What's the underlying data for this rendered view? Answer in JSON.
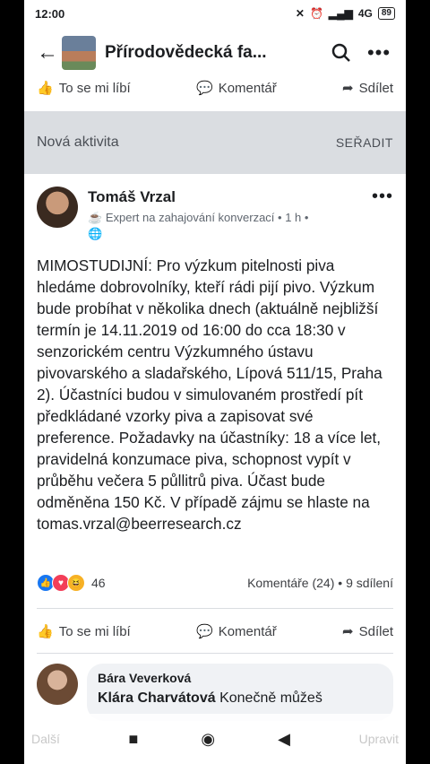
{
  "status": {
    "time": "12:00",
    "signal": "4G",
    "battery": "89"
  },
  "appbar": {
    "title": "Přírodovědecká fa..."
  },
  "actions": {
    "like": "To se mi líbí",
    "comment": "Komentář",
    "share": "Sdílet"
  },
  "activity": {
    "title": "Nová aktivita",
    "sort": "SEŘADIT"
  },
  "post": {
    "author": "Tomáš Vrzal",
    "badge": "Expert na zahajování konverzací",
    "time": "1 h",
    "text": "MIMOSTUDIJNÍ: Pro výzkum pitelnosti piva hledáme dobrovolníky, kteří rádi pijí pivo. Výzkum bude probíhat v několika dnech (aktuálně nejbližší termín je 14.11.2019 od 16:00 do cca 18:30 v senzorickém centru Výzkumného ústavu pivovarského a sladařského, Lípová 511/15, Praha 2). Účastníci budou v simulovaném prostředí pít předkládané vzorky piva a zapisovat své preference. Požadavky na účastníky: 18 a více let, pravidelná konzumace piva, schopnost vypít v průběhu večera 5 půllitrů piva. Účast bude odměněna 150 Kč. V případě zájmu se hlaste na tomas.vrzal@beerresearch.cz",
    "reaction_count": "46",
    "comments": "Komentáře (24)",
    "shares": "9 sdílení"
  },
  "comment": {
    "author": "Bára Veverková",
    "mention": "Klára Charvátová",
    "text": "Konečně můžeš"
  },
  "navbar": {
    "left": "Další",
    "right": "Upravit"
  }
}
